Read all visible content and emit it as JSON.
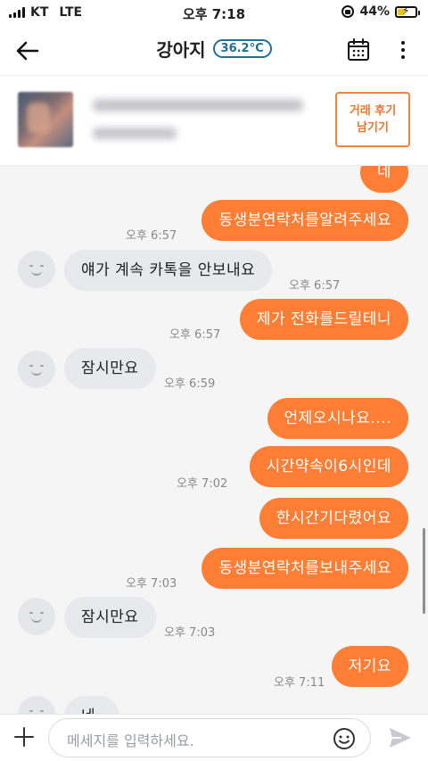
{
  "status_bar": {
    "carrier": "KT",
    "network": "LTE",
    "time": "오후 7:18",
    "battery": "44%",
    "battery_level": 0.44
  },
  "header": {
    "title": "강아지",
    "temperature": "36.2°C"
  },
  "product": {
    "review_button": [
      "거래 후기",
      "남기기"
    ]
  },
  "messages": [
    {
      "side": "me",
      "text": "네",
      "time": ""
    },
    {
      "side": "me",
      "text": "동생분연락처를알려주세요",
      "time": "오후 6:57"
    },
    {
      "side": "them",
      "text": "얘가 계속 카톡을 안보내요",
      "time": "오후 6:57"
    },
    {
      "side": "me",
      "text": "제가 전화를드릴테니",
      "time": "오후 6:57"
    },
    {
      "side": "them",
      "text": "잠시만요",
      "time": "오후 6:59"
    },
    {
      "side": "me",
      "text": "언제오시나요....",
      "time": ""
    },
    {
      "side": "me",
      "text": "시간약속이6시인데",
      "time": "오후 7:02"
    },
    {
      "side": "me",
      "text": "한시간기다렸어요",
      "time": ""
    },
    {
      "side": "me",
      "text": "동생분연락처를보내주세요",
      "time": "오후 7:03"
    },
    {
      "side": "them",
      "text": "잠시만요",
      "time": "오후 7:03"
    },
    {
      "side": "me",
      "text": "저기요",
      "time": "오후 7:11"
    },
    {
      "side": "them",
      "text": "네",
      "time": ""
    }
  ],
  "input": {
    "placeholder": "메세지를 입력하세요."
  },
  "colors": {
    "accent": "#ff7e35",
    "temperature": "#1e6e96",
    "other_bubble": "#e8e9ec",
    "chat_background": "#f5f5f6"
  }
}
